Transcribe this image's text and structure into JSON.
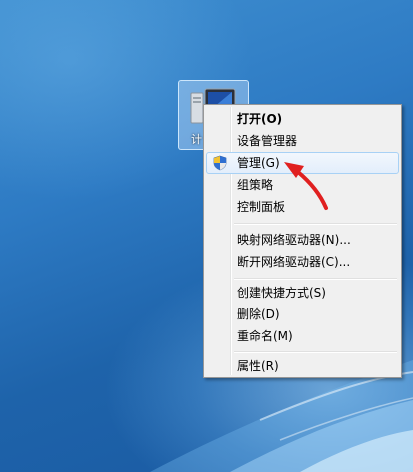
{
  "desktop": {
    "icon_label": "计",
    "icon_name": "computer-icon"
  },
  "context_menu": {
    "items": [
      {
        "label": "打开(O)",
        "bold": true
      },
      {
        "label": "设备管理器"
      },
      {
        "label": "管理(G)",
        "highlighted": true,
        "icon": "uac-shield-icon"
      },
      {
        "label": "组策略"
      },
      {
        "label": "控制面板"
      },
      {
        "label": "映射网络驱动器(N)..."
      },
      {
        "label": "断开网络驱动器(C)..."
      },
      {
        "label": "创建快捷方式(S)"
      },
      {
        "label": "删除(D)"
      },
      {
        "label": "重命名(M)"
      },
      {
        "label": "属性(R)"
      }
    ]
  },
  "annotation": {
    "arrow_color": "#e02020"
  }
}
